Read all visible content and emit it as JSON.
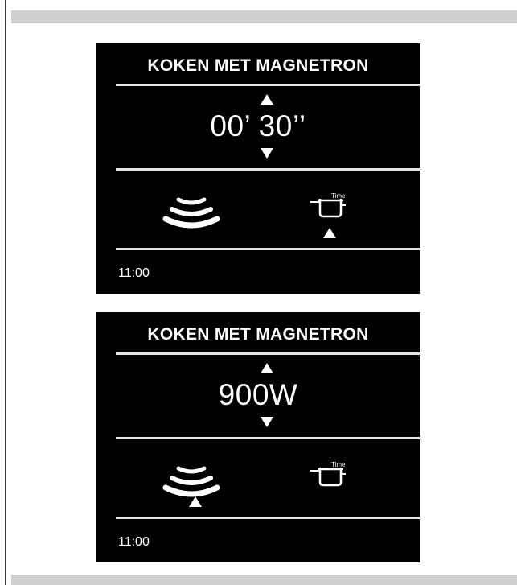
{
  "screens": [
    {
      "title": "KOKEN MET MAGNETRON",
      "value": "00’ 30’’",
      "selected_mode": "time",
      "clock": "11:00",
      "icons": {
        "power": "microwave-waves-icon",
        "time": "cooking-time-icon",
        "time_label": "Time"
      }
    },
    {
      "title": "KOKEN MET MAGNETRON",
      "value": "900W",
      "selected_mode": "power",
      "clock": "11:00",
      "icons": {
        "power": "microwave-waves-icon",
        "time": "cooking-time-icon",
        "time_label": "Time"
      }
    }
  ],
  "colors": {
    "screen_bg": "#000000",
    "foreground": "#ffffff",
    "page_bar": "#cfcfcf"
  }
}
